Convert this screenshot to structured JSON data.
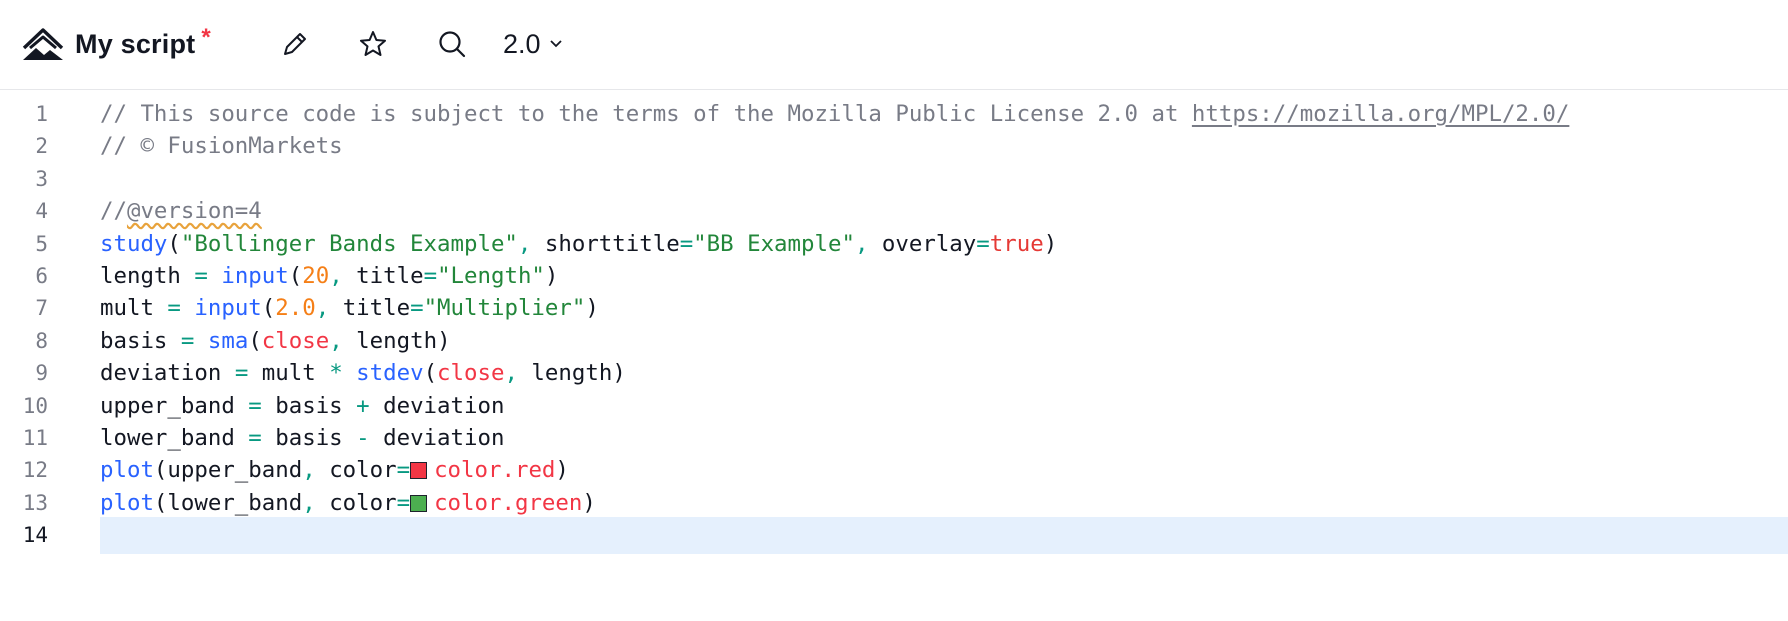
{
  "toolbar": {
    "logo_icon": "pine-mountain-icon",
    "title": "My script",
    "unsaved_marker": "*",
    "edit_icon": "pencil-icon",
    "favorite_icon": "star-icon",
    "search_icon": "search-icon",
    "version_label": "2.0",
    "version_icon": "chevron-down-icon"
  },
  "editor": {
    "current_line": 14,
    "colors": {
      "comment": "#787b86",
      "function": "#2962ff",
      "string": "#22863a",
      "number": "#f57f17",
      "operator": "#089981",
      "keyword": "#e53935",
      "current_line_bg": "#e5f0fd",
      "swatch_red": "#f23645",
      "swatch_green": "#4caf50"
    },
    "lines": [
      {
        "number": "1",
        "tokens": [
          {
            "t": "// This source code is subject to the terms of the Mozilla Public License 2.0 at ",
            "c": "com"
          },
          {
            "t": "https://mozilla.org/MPL/2.0/",
            "c": "link"
          }
        ]
      },
      {
        "number": "2",
        "tokens": [
          {
            "t": "// © FusionMarkets",
            "c": "com"
          }
        ]
      },
      {
        "number": "3",
        "tokens": []
      },
      {
        "number": "4",
        "tokens": [
          {
            "t": "//",
            "c": "com"
          },
          {
            "t": "@version=4",
            "c": "ver"
          }
        ]
      },
      {
        "number": "5",
        "tokens": [
          {
            "t": "study",
            "c": "fn"
          },
          {
            "t": "(",
            "c": "id"
          },
          {
            "t": "\"Bollinger Bands Example\"",
            "c": "str"
          },
          {
            "t": ", ",
            "c": "op"
          },
          {
            "t": "shorttitle",
            "c": "id"
          },
          {
            "t": "=",
            "c": "op"
          },
          {
            "t": "\"BB Example\"",
            "c": "str"
          },
          {
            "t": ", ",
            "c": "op"
          },
          {
            "t": "overlay",
            "c": "id"
          },
          {
            "t": "=",
            "c": "op"
          },
          {
            "t": "true",
            "c": "kw"
          },
          {
            "t": ")",
            "c": "id"
          }
        ]
      },
      {
        "number": "6",
        "tokens": [
          {
            "t": "length ",
            "c": "id"
          },
          {
            "t": "=",
            "c": "op"
          },
          {
            "t": " ",
            "c": "id"
          },
          {
            "t": "input",
            "c": "fn"
          },
          {
            "t": "(",
            "c": "id"
          },
          {
            "t": "20",
            "c": "num"
          },
          {
            "t": ", ",
            "c": "op"
          },
          {
            "t": "title",
            "c": "id"
          },
          {
            "t": "=",
            "c": "op"
          },
          {
            "t": "\"Length\"",
            "c": "str"
          },
          {
            "t": ")",
            "c": "id"
          }
        ]
      },
      {
        "number": "7",
        "tokens": [
          {
            "t": "mult ",
            "c": "id"
          },
          {
            "t": "=",
            "c": "op"
          },
          {
            "t": " ",
            "c": "id"
          },
          {
            "t": "input",
            "c": "fn"
          },
          {
            "t": "(",
            "c": "id"
          },
          {
            "t": "2.0",
            "c": "num"
          },
          {
            "t": ", ",
            "c": "op"
          },
          {
            "t": "title",
            "c": "id"
          },
          {
            "t": "=",
            "c": "op"
          },
          {
            "t": "\"Multiplier\"",
            "c": "str"
          },
          {
            "t": ")",
            "c": "id"
          }
        ]
      },
      {
        "number": "8",
        "tokens": [
          {
            "t": "basis ",
            "c": "id"
          },
          {
            "t": "=",
            "c": "op"
          },
          {
            "t": " ",
            "c": "id"
          },
          {
            "t": "sma",
            "c": "fn"
          },
          {
            "t": "(",
            "c": "id"
          },
          {
            "t": "close",
            "c": "var"
          },
          {
            "t": ", ",
            "c": "op"
          },
          {
            "t": "length",
            "c": "id"
          },
          {
            "t": ")",
            "c": "id"
          }
        ]
      },
      {
        "number": "9",
        "tokens": [
          {
            "t": "deviation ",
            "c": "id"
          },
          {
            "t": "=",
            "c": "op"
          },
          {
            "t": " mult ",
            "c": "id"
          },
          {
            "t": "*",
            "c": "op"
          },
          {
            "t": " ",
            "c": "id"
          },
          {
            "t": "stdev",
            "c": "fn"
          },
          {
            "t": "(",
            "c": "id"
          },
          {
            "t": "close",
            "c": "var"
          },
          {
            "t": ", ",
            "c": "op"
          },
          {
            "t": "length",
            "c": "id"
          },
          {
            "t": ")",
            "c": "id"
          }
        ]
      },
      {
        "number": "10",
        "tokens": [
          {
            "t": "upper_band ",
            "c": "id"
          },
          {
            "t": "=",
            "c": "op"
          },
          {
            "t": " basis ",
            "c": "id"
          },
          {
            "t": "+",
            "c": "op"
          },
          {
            "t": " deviation",
            "c": "id"
          }
        ]
      },
      {
        "number": "11",
        "tokens": [
          {
            "t": "lower_band ",
            "c": "id"
          },
          {
            "t": "=",
            "c": "op"
          },
          {
            "t": " basis ",
            "c": "id"
          },
          {
            "t": "-",
            "c": "op"
          },
          {
            "t": " deviation",
            "c": "id"
          }
        ]
      },
      {
        "number": "12",
        "tokens": [
          {
            "t": "plot",
            "c": "fn"
          },
          {
            "t": "(",
            "c": "id"
          },
          {
            "t": "upper_band",
            "c": "id"
          },
          {
            "t": ", ",
            "c": "op"
          },
          {
            "t": "color",
            "c": "id"
          },
          {
            "t": "=",
            "c": "op"
          },
          {
            "swatch": "#f23645",
            "name": "color-swatch-red"
          },
          {
            "t": "color.red",
            "c": "var"
          },
          {
            "t": ")",
            "c": "id"
          }
        ]
      },
      {
        "number": "13",
        "tokens": [
          {
            "t": "plot",
            "c": "fn"
          },
          {
            "t": "(",
            "c": "id"
          },
          {
            "t": "lower_band",
            "c": "id"
          },
          {
            "t": ", ",
            "c": "op"
          },
          {
            "t": "color",
            "c": "id"
          },
          {
            "t": "=",
            "c": "op"
          },
          {
            "swatch": "#4caf50",
            "name": "color-swatch-green"
          },
          {
            "t": "color.green",
            "c": "var"
          },
          {
            "t": ")",
            "c": "id"
          }
        ]
      },
      {
        "number": "14",
        "tokens": []
      }
    ]
  }
}
